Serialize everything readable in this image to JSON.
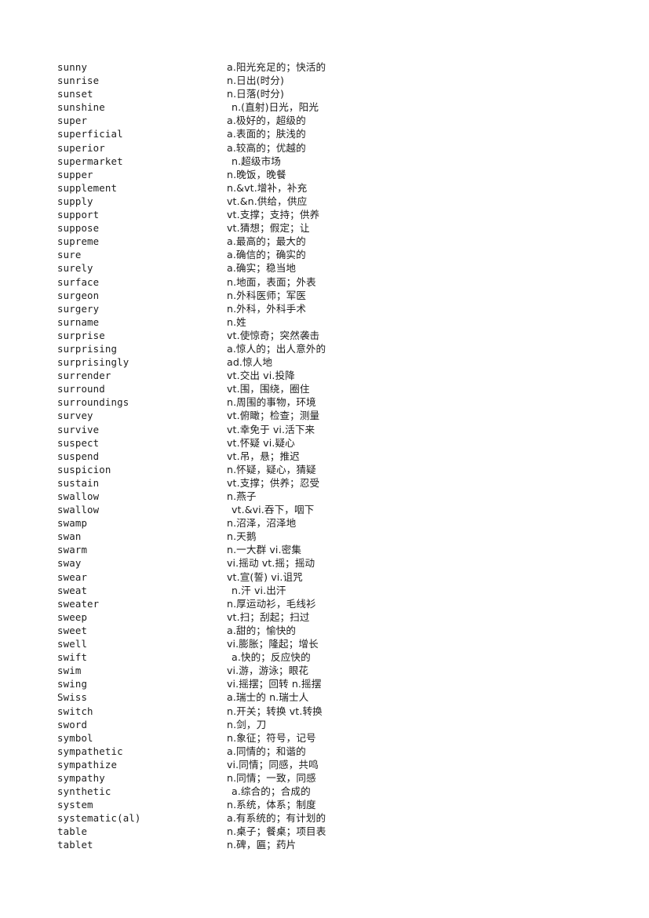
{
  "page": {
    "kind": "vocabulary-list",
    "background_color": "#ffffff",
    "text_color": "#1c1c1c",
    "word_count": 60
  },
  "entries": [
    {
      "word": "sunny",
      "meaning": "a.阳光充足的；快活的",
      "indent": false
    },
    {
      "word": "sunrise",
      "meaning": "n.日出(时分)",
      "indent": false
    },
    {
      "word": "sunset",
      "meaning": "n.日落(时分)",
      "indent": false
    },
    {
      "word": "sunshine",
      "meaning": "n.(直射)日光，阳光",
      "indent": true
    },
    {
      "word": "super",
      "meaning": "a.极好的，超级的",
      "indent": false
    },
    {
      "word": "superficial",
      "meaning": "a.表面的；肤浅的",
      "indent": false
    },
    {
      "word": "superior",
      "meaning": "a.较高的；优越的",
      "indent": false
    },
    {
      "word": "supermarket",
      "meaning": "n.超级市场",
      "indent": true
    },
    {
      "word": "supper",
      "meaning": "n.晚饭，晚餐",
      "indent": false
    },
    {
      "word": "supplement",
      "meaning": "n.&vt.增补，补充",
      "indent": false
    },
    {
      "word": "supply",
      "meaning": "vt.&n.供给，供应",
      "indent": false
    },
    {
      "word": "support",
      "meaning": "vt.支撑；支持；供养",
      "indent": false
    },
    {
      "word": "suppose",
      "meaning": "vt.猜想；假定；让",
      "indent": false
    },
    {
      "word": "supreme",
      "meaning": "a.最高的；最大的",
      "indent": false
    },
    {
      "word": "sure",
      "meaning": "a.确信的；确实的",
      "indent": false
    },
    {
      "word": "surely",
      "meaning": "a.确实；稳当地",
      "indent": false
    },
    {
      "word": "surface",
      "meaning": "n.地面，表面；外表",
      "indent": false
    },
    {
      "word": "surgeon",
      "meaning": "n.外科医师；军医",
      "indent": false
    },
    {
      "word": "surgery",
      "meaning": "n.外科，外科手术",
      "indent": false
    },
    {
      "word": "surname",
      "meaning": "n.姓",
      "indent": false
    },
    {
      "word": "surprise",
      "meaning": "vt.使惊奇；突然袭击",
      "indent": false
    },
    {
      "word": "surprising",
      "meaning": "a.惊人的；出人意外的",
      "indent": false
    },
    {
      "word": "surprisingly",
      "meaning": "ad.惊人地",
      "indent": false
    },
    {
      "word": "surrender",
      "meaning": "vt.交出 vi.投降",
      "indent": false
    },
    {
      "word": "surround",
      "meaning": "vt.围，围绕，圈住",
      "indent": false
    },
    {
      "word": "surroundings",
      "meaning": "n.周围的事物，环境",
      "indent": false
    },
    {
      "word": "survey",
      "meaning": "vt.俯瞰；检查；测量",
      "indent": false
    },
    {
      "word": "survive",
      "meaning": "vt.幸免于 vi.活下来",
      "indent": false
    },
    {
      "word": "suspect",
      "meaning": "vt.怀疑 vi.疑心",
      "indent": false
    },
    {
      "word": "suspend",
      "meaning": "vt.吊，悬；推迟",
      "indent": false
    },
    {
      "word": "suspicion",
      "meaning": "n.怀疑，疑心，猜疑",
      "indent": false
    },
    {
      "word": "sustain",
      "meaning": "vt.支撑；供养；忍受",
      "indent": false
    },
    {
      "word": "swallow",
      "meaning": "n.燕子",
      "indent": false
    },
    {
      "word": "swallow",
      "meaning": "vt.&vi.吞下，咽下",
      "indent": true
    },
    {
      "word": "swamp",
      "meaning": "n.沼泽，沼泽地",
      "indent": false
    },
    {
      "word": "swan",
      "meaning": "n.天鹅",
      "indent": false
    },
    {
      "word": "swarm",
      "meaning": "n.一大群 vi.密集",
      "indent": false
    },
    {
      "word": "sway",
      "meaning": "vi.摇动 vt.摇；摇动",
      "indent": false
    },
    {
      "word": "swear",
      "meaning": "vt.宣(誓) vi.诅咒",
      "indent": false
    },
    {
      "word": "sweat",
      "meaning": "n.汗 vi.出汗",
      "indent": true
    },
    {
      "word": "sweater",
      "meaning": "n.厚运动衫，毛线衫",
      "indent": false
    },
    {
      "word": "sweep",
      "meaning": "vt.扫；刮起；扫过",
      "indent": false
    },
    {
      "word": "sweet",
      "meaning": "a.甜的；愉快的",
      "indent": false
    },
    {
      "word": "swell",
      "meaning": "vi.膨胀；隆起；增长",
      "indent": false
    },
    {
      "word": "swift",
      "meaning": "a.快的；反应快的",
      "indent": true
    },
    {
      "word": "swim",
      "meaning": "vi.游，游泳；眼花",
      "indent": false
    },
    {
      "word": "swing",
      "meaning": "vi.摇摆；回转 n.摇摆",
      "indent": false
    },
    {
      "word": "Swiss",
      "meaning": "a.瑞士的 n.瑞士人",
      "indent": false
    },
    {
      "word": "switch",
      "meaning": "n.开关；转换 vt.转换",
      "indent": false
    },
    {
      "word": "sword",
      "meaning": "n.剑，刀",
      "indent": false
    },
    {
      "word": "symbol",
      "meaning": "n.象征；符号，记号",
      "indent": false
    },
    {
      "word": "sympathetic",
      "meaning": "a.同情的；和谐的",
      "indent": false
    },
    {
      "word": "sympathize",
      "meaning": "vi.同情；同感，共鸣",
      "indent": false
    },
    {
      "word": "sympathy",
      "meaning": "n.同情；一致，同感",
      "indent": false
    },
    {
      "word": "synthetic",
      "meaning": "a.综合的；合成的",
      "indent": true
    },
    {
      "word": "system",
      "meaning": "n.系统，体系；制度",
      "indent": false
    },
    {
      "word": "systematic(al)",
      "meaning": "a.有系统的；有计划的",
      "indent": false
    },
    {
      "word": "table",
      "meaning": "n.桌子；餐桌；项目表",
      "indent": false
    },
    {
      "word": "tablet",
      "meaning": "n.碑，匾；药片",
      "indent": false
    }
  ]
}
